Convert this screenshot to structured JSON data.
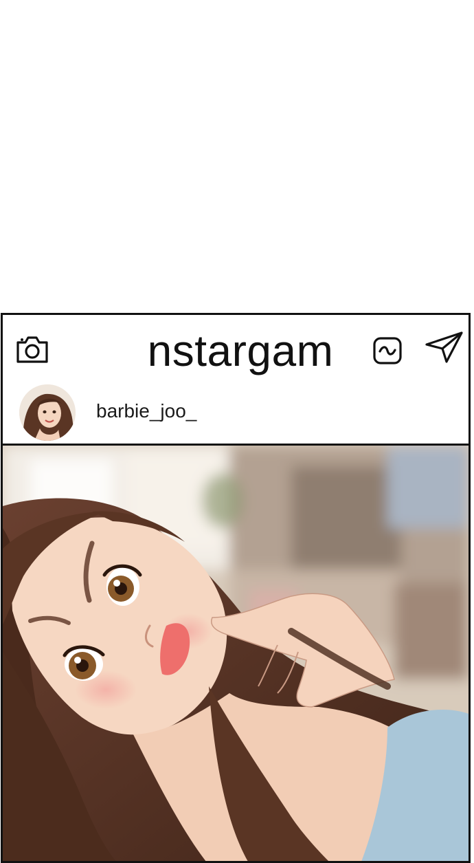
{
  "header": {
    "app_title": "nstargam",
    "icons": {
      "camera": "camera-icon",
      "activity": "activity-icon",
      "send": "send-icon"
    }
  },
  "post": {
    "username": "barbie_joo_",
    "avatar": "avatar",
    "image": "post-photo"
  },
  "colors": {
    "border": "#111111",
    "background": "#ffffff",
    "hair": "#5a3524",
    "skin": "#f6d8c4",
    "top": "#a9c6d8"
  }
}
